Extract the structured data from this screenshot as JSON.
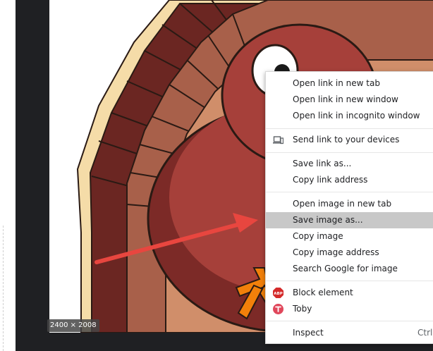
{
  "image": {
    "dimensions": "2400 × 2008",
    "alt": "cartoon turkey"
  },
  "menu": {
    "items": [
      {
        "label": "Open link in new tab"
      },
      {
        "label": "Open link in new window"
      },
      {
        "label": "Open link in incognito window"
      },
      {
        "label": "Send link to your devices",
        "icon": "devices-icon"
      },
      {
        "label": "Save link as..."
      },
      {
        "label": "Copy link address"
      },
      {
        "label": "Open image in new tab"
      },
      {
        "label": "Save image as...",
        "highlighted": true
      },
      {
        "label": "Copy image"
      },
      {
        "label": "Copy image address"
      },
      {
        "label": "Search Google for image"
      },
      {
        "label": "Block element",
        "icon": "abp-icon"
      },
      {
        "label": "Toby",
        "icon": "toby-icon"
      },
      {
        "label": "Inspect",
        "shortcut": "Ctrl+"
      }
    ],
    "abp_text": "ABP"
  },
  "colors": {
    "arrow": "#e8463f",
    "hover": "#c8c8c8",
    "abp": "#d42a2a",
    "toby": "#e0475b"
  }
}
